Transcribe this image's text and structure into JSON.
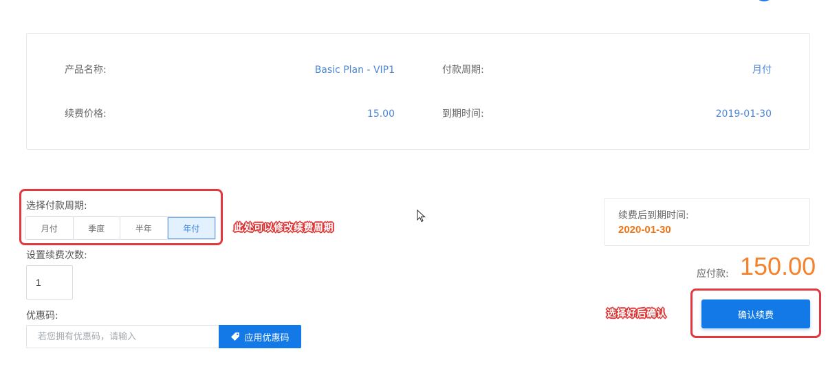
{
  "info": {
    "product_name_label": "产品名称:",
    "product_name_value": "Basic Plan - VIP1",
    "payment_cycle_label": "付款周期:",
    "payment_cycle_value": "月付",
    "renew_price_label": "续费价格:",
    "renew_price_value": "15.00",
    "expiry_label": "到期时间:",
    "expiry_value": "2019-01-30"
  },
  "period": {
    "label": "选择付款周期:",
    "options": [
      "月付",
      "季度",
      "半年",
      "年付"
    ],
    "selected": "年付"
  },
  "annotations": {
    "period_note": "此处可以修改续费周期",
    "confirm_note": "选择好后确认"
  },
  "times": {
    "label": "设置续费次数:",
    "value": "1"
  },
  "coupon": {
    "label": "优惠码:",
    "placeholder": "若您拥有优惠码，请输入",
    "button_label": "应用优惠码"
  },
  "summary": {
    "new_expiry_label": "续费后到期时间:",
    "new_expiry_value": "2020-01-30",
    "pay_label": "应付款:",
    "pay_amount": "150.00"
  },
  "confirm": {
    "button_label": "确认续费"
  },
  "colors": {
    "accent": "#1279e7",
    "value_blue": "#4a86d4",
    "amount_orange": "#f5822a",
    "annotation_red": "#e0383e"
  }
}
